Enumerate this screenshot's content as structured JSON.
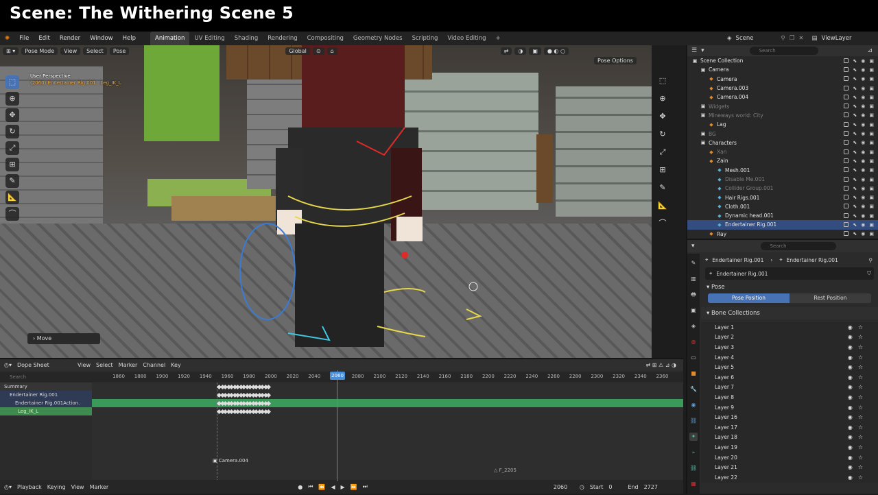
{
  "scene_title": "Scene: The Withering Scene 5",
  "menu": [
    "File",
    "Edit",
    "Render",
    "Window",
    "Help"
  ],
  "workspaces": [
    "Animation",
    "UV Editing",
    "Shading",
    "Rendering",
    "Compositing",
    "Geometry Nodes",
    "Scripting",
    "Video Editing"
  ],
  "active_workspace": "Animation",
  "add_workspace": "+",
  "scene_selector": {
    "scene": "Scene",
    "view_layer": "ViewLayer"
  },
  "viewport": {
    "mode": "Pose Mode",
    "menus": [
      "View",
      "Select",
      "Pose"
    ],
    "orientation": "Global",
    "perspective": "User Perspective",
    "object_info": "(2060) Endertainer Rig.001 : Leg_IK_L",
    "pose_options": "Pose Options",
    "last_operator": "Move"
  },
  "outliner": {
    "search_placeholder": "Search",
    "rows": [
      {
        "label": "Scene Collection",
        "indent": 0,
        "dim": false
      },
      {
        "label": "Camera",
        "indent": 1,
        "dim": false
      },
      {
        "label": "Camera",
        "indent": 2,
        "dim": false
      },
      {
        "label": "Camera.003",
        "indent": 2,
        "dim": false
      },
      {
        "label": "Camera.004",
        "indent": 2,
        "dim": false
      },
      {
        "label": "Widgets",
        "indent": 1,
        "dim": true
      },
      {
        "label": "Mineways world: City",
        "indent": 1,
        "dim": true
      },
      {
        "label": "Lag",
        "indent": 2,
        "dim": false
      },
      {
        "label": "BG",
        "indent": 1,
        "dim": true
      },
      {
        "label": "Characters",
        "indent": 1,
        "dim": false
      },
      {
        "label": "Xan",
        "indent": 2,
        "dim": true
      },
      {
        "label": "Zain",
        "indent": 2,
        "dim": false
      },
      {
        "label": "Mesh.001",
        "indent": 3,
        "dim": false
      },
      {
        "label": "Disable Me.001",
        "indent": 3,
        "dim": true
      },
      {
        "label": "Collider Group.001",
        "indent": 3,
        "dim": true
      },
      {
        "label": "Hair Rigs.001",
        "indent": 3,
        "dim": false
      },
      {
        "label": "Cloth.001",
        "indent": 3,
        "dim": false
      },
      {
        "label": "Dynamic head.001",
        "indent": 3,
        "dim": false
      },
      {
        "label": "Endertainer Rig.001",
        "indent": 3,
        "dim": false,
        "selected": true
      },
      {
        "label": "Ray",
        "indent": 2,
        "dim": false
      }
    ]
  },
  "properties": {
    "search_placeholder": "Search",
    "breadcrumb": [
      "Endertainer Rig.001",
      "Endertainer Rig.001"
    ],
    "armature_name": "Endertainer Rig.001",
    "pose_panel": "Pose",
    "pose_position": "Pose Position",
    "rest_position": "Rest Position",
    "bone_collections_panel": "Bone Collections",
    "layers": [
      "Layer 1",
      "Layer 2",
      "Layer 3",
      "Layer 4",
      "Layer 5",
      "Layer 6",
      "Layer 7",
      "Layer 8",
      "Layer 9",
      "Layer 16",
      "Layer 17",
      "Layer 18",
      "Layer 19",
      "Layer 20",
      "Layer 21",
      "Layer 22"
    ]
  },
  "dopesheet": {
    "editor": "Dope Sheet",
    "menus": [
      "View",
      "Select",
      "Marker",
      "Channel",
      "Key"
    ],
    "search_placeholder": "Search",
    "ruler": [
      1860,
      1880,
      1900,
      1920,
      1940,
      1960,
      1980,
      2000,
      2020,
      2040,
      2060,
      2080,
      2100,
      2120,
      2140,
      2160,
      2180,
      2200,
      2220,
      2240,
      2260,
      2280,
      2300,
      2320,
      2340,
      2360
    ],
    "current_frame": "2060",
    "channels": [
      "Summary",
      "Endertainer Rig.001",
      "Endertainer Rig.001Action.",
      "Leg_IK_L"
    ],
    "marker_camera": "Camera.004",
    "marker_f": "F_2205"
  },
  "playback": {
    "menus": [
      "Playback",
      "Keying",
      "View",
      "Marker"
    ],
    "frame": "2060",
    "start_label": "Start",
    "start": "0",
    "end_label": "End",
    "end": "2727"
  }
}
